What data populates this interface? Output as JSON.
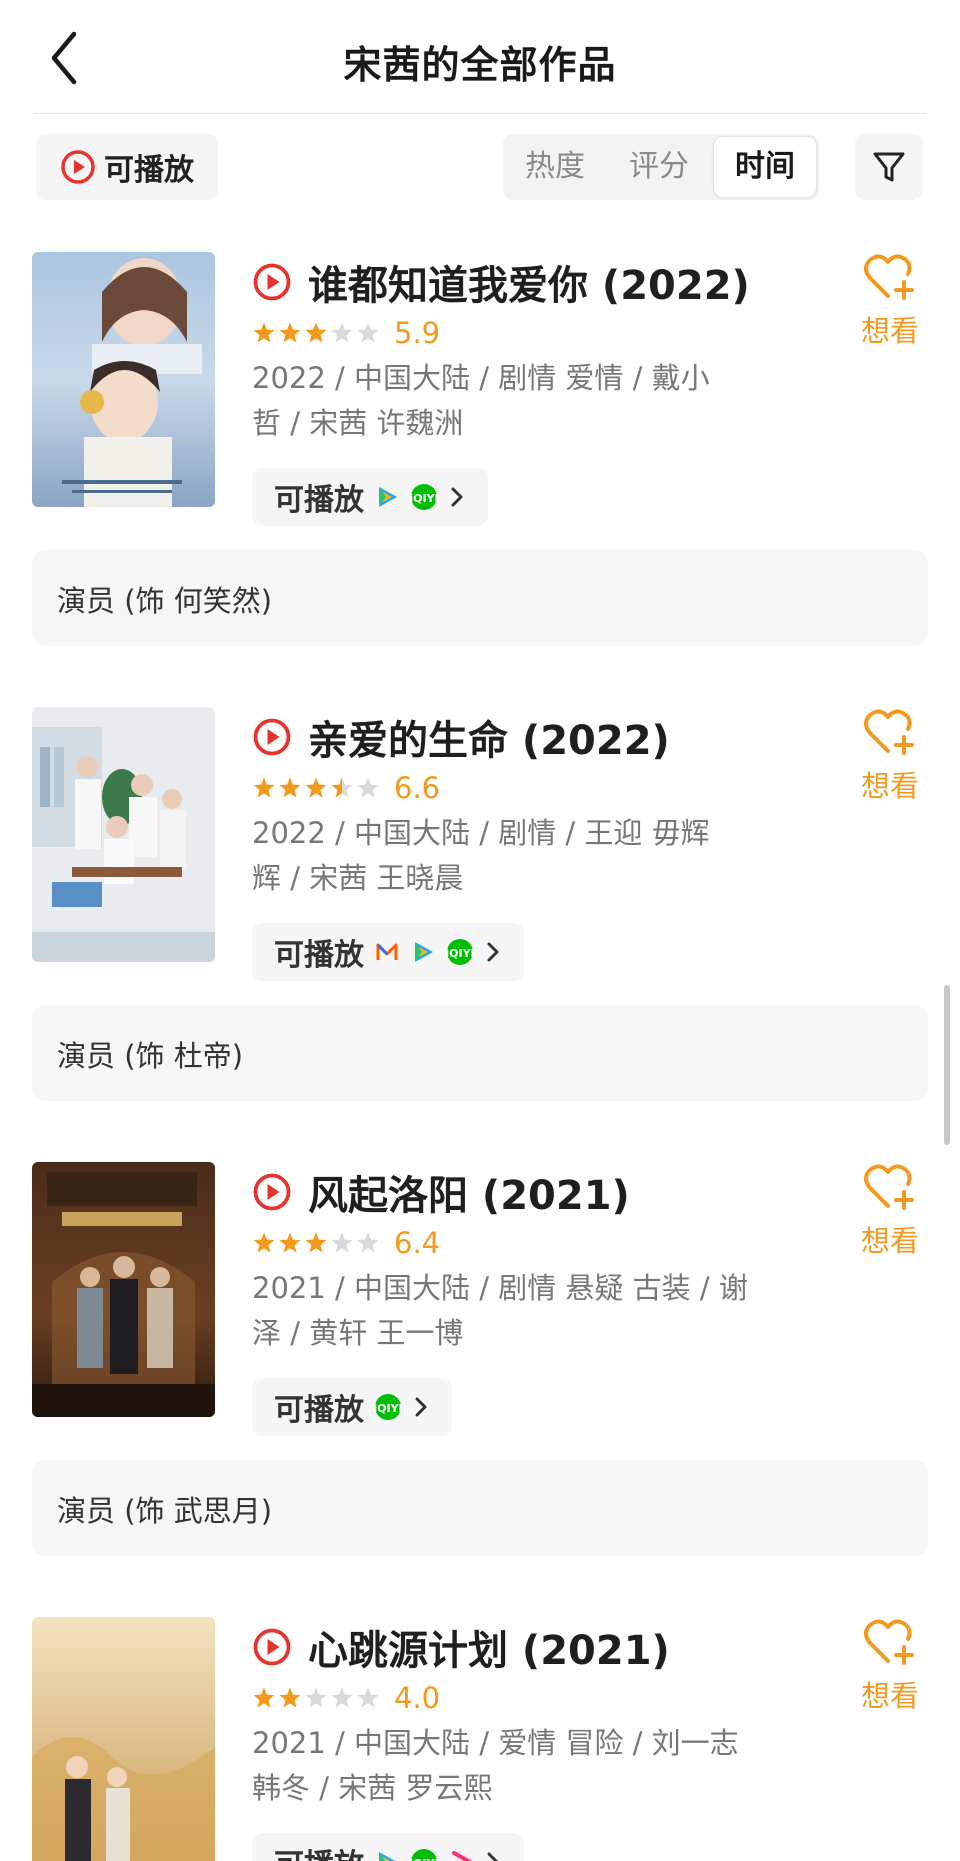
{
  "header": {
    "title": "宋茜的全部作品"
  },
  "toolbar": {
    "playable_label": "可播放",
    "sort_tabs": [
      "热度",
      "评分",
      "时间"
    ],
    "active_sort": "时间"
  },
  "colors": {
    "accent_orange": "#f29a1f",
    "play_red": "#e7332e",
    "star_gold": "#f39a1c"
  },
  "works": [
    {
      "title": "谁都知道我爱你 (2022)",
      "stars": 3,
      "score": "5.9",
      "meta_line1": "2022 / 中国大陆 / 剧情 爱情 / 戴小",
      "meta_line2": "哲 / 宋茜 许魏洲",
      "play_label": "可播放",
      "platforms": [
        "tencent-video-icon",
        "iqiyi-icon"
      ],
      "wish_label": "想看",
      "role": "演员 (饰 何笑然)"
    },
    {
      "title": "亲爱的生命 (2022)",
      "stars": 3.5,
      "score": "6.6",
      "meta_line1": "2022 / 中国大陆 / 剧情 / 王迎 毋辉",
      "meta_line2": "辉 / 宋茜 王晓晨",
      "play_label": "可播放",
      "platforms": [
        "mgtv-icon",
        "tencent-video-icon",
        "iqiyi-icon"
      ],
      "wish_label": "想看",
      "role": "演员 (饰 杜帝)"
    },
    {
      "title": "风起洛阳 (2021)",
      "stars": 3,
      "score": "6.4",
      "meta_line1": "2021 / 中国大陆 / 剧情 悬疑 古装 / 谢",
      "meta_line2": "泽 / 黄轩 王一博",
      "play_label": "可播放",
      "platforms": [
        "iqiyi-icon"
      ],
      "wish_label": "想看",
      "role": "演员 (饰 武思月)"
    },
    {
      "title": "心跳源计划 (2021)",
      "stars": 2,
      "score": "4.0",
      "meta_line1": "2021 / 中国大陆 / 爱情 冒险 / 刘一志",
      "meta_line2": "韩冬 / 宋茜 罗云熙",
      "play_label": "可播放",
      "platforms": [
        "tencent-video-icon",
        "iqiyi-icon",
        "youku-icon"
      ],
      "wish_label": "想看",
      "role": ""
    }
  ]
}
